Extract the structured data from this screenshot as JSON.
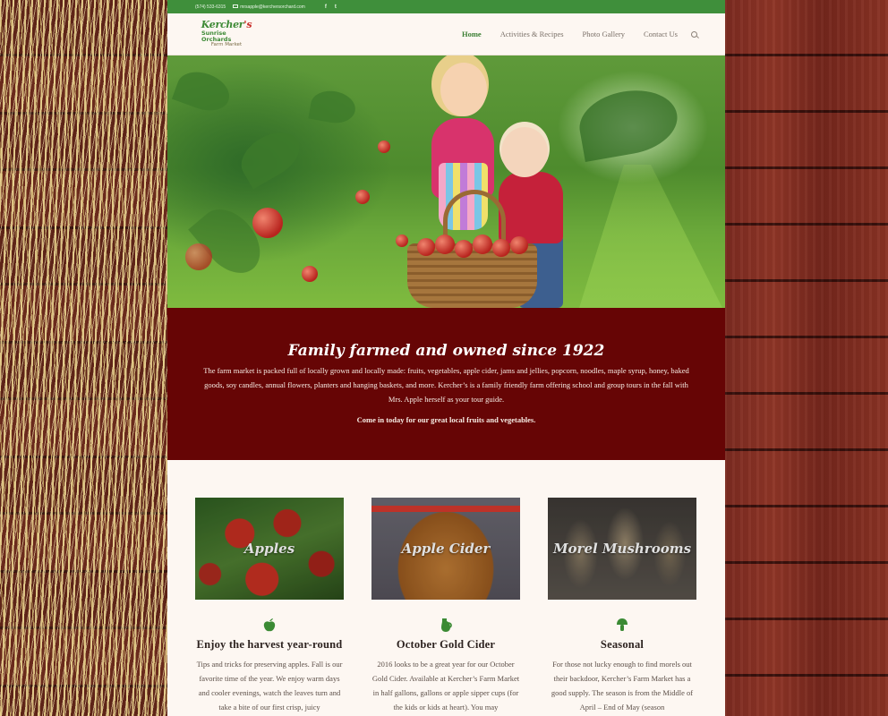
{
  "topbar": {
    "phone": "(574) 533-6315",
    "email": "mrsapple@kerchersorchard.com",
    "social": [
      "f",
      "t"
    ]
  },
  "logo": {
    "line1a": "Kercher",
    "line1b": "'s",
    "line2": "Sunrise Orchards",
    "line3": "Farm Market"
  },
  "nav": {
    "items": [
      "Home",
      "Activities & Recipes",
      "Photo Gallery",
      "Contact Us"
    ],
    "active": "Home"
  },
  "band": {
    "heading": "Family farmed and owned since 1922",
    "body": "The farm market is packed full of locally grown and locally made: fruits, vegetables, apple cider, jams and jellies, popcorn, noodles, maple syrup, honey, baked goods, soy candles, annual flowers, planters and hanging baskets, and more. Kercher’s is a family friendly farm offering school and group tours in the fall with Mrs. Apple herself as your tour guide.",
    "cta": "Come in today for our great local fruits and vegetables."
  },
  "features": [
    {
      "thumb_title": "Apples",
      "icon": "apple-icon",
      "heading": "Enjoy the harvest year-round",
      "text": "Tips and tricks for preserving apples. Fall is our favorite time of the year. We enjoy warm days and cooler evenings, watch the leaves turn and take a bite of our first crisp, juicy"
    },
    {
      "thumb_title": "Apple Cider",
      "icon": "jug-icon",
      "heading": "October Gold Cider",
      "text": "2016 looks to be a great year for our October Gold Cider. Available at Kercher’s Farm Market in half gallons, gallons or apple sipper cups (for the kids or kids at heart). You may"
    },
    {
      "thumb_title": "Morel Mushrooms",
      "icon": "mushroom-icon",
      "heading": "Seasonal",
      "text": "For those not lucky enough to find morels out their backdoor, Kercher’s Farm Market has a good supply. The season is from the Middle of April – End of May (season"
    }
  ],
  "colors": {
    "green": "#3f8f3b",
    "maroon": "#660505",
    "page_bg": "#fdf7f2"
  }
}
